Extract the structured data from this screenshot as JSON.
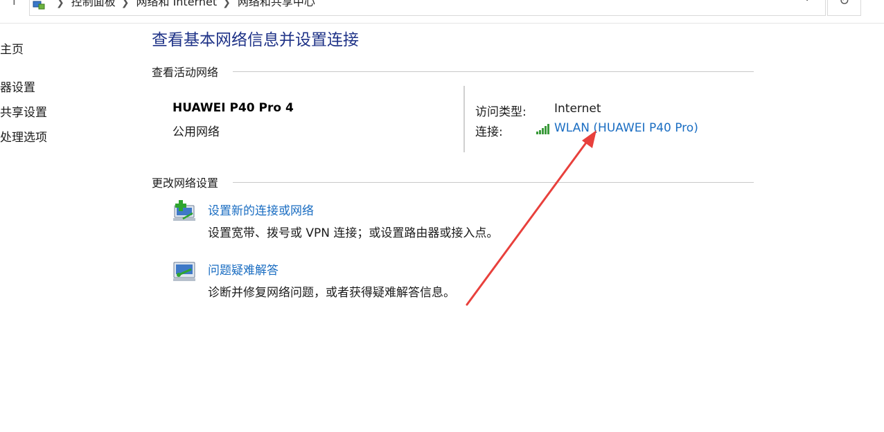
{
  "breadcrumb": {
    "items": [
      "控制面板",
      "网络和 Internet",
      "网络和共享中心"
    ]
  },
  "sidebar": {
    "items": [
      {
        "label": "主页"
      },
      {
        "label": "器设置"
      },
      {
        "label": "共享设置"
      },
      {
        "label": "处理选项"
      }
    ]
  },
  "main": {
    "title": "查看基本网络信息并设置连接",
    "active_section": {
      "heading": "查看活动网络",
      "network_name": "HUAWEI P40 Pro 4",
      "network_type": "公用网络",
      "access_type_label": "访问类型:",
      "access_type_value": "Internet",
      "connection_label": "连接:",
      "connection_link": "WLAN (HUAWEI P40 Pro)"
    },
    "change_section": {
      "heading": "更改网络设置",
      "tasks": [
        {
          "link": "设置新的连接或网络",
          "desc": "设置宽带、拨号或 VPN 连接；或设置路由器或接入点。",
          "icon": "new-connection-icon"
        },
        {
          "link": "问题疑难解答",
          "desc": "诊断并修复网络问题，或者获得疑难解答信息。",
          "icon": "troubleshoot-icon"
        }
      ]
    }
  },
  "colors": {
    "title": "#1e3287",
    "link": "#1a6dc2",
    "annotation_arrow": "#e8403c"
  }
}
